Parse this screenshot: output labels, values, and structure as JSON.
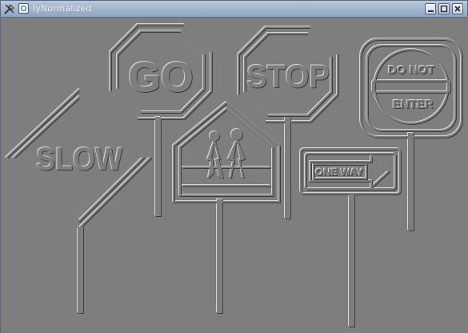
{
  "window": {
    "title": "IyNormalized",
    "buttons": {
      "minimize": "minimize",
      "maximize": "maximize",
      "close": "close"
    }
  },
  "icons": [
    "app-tools-icon",
    "system-menu-icon",
    "minimize-icon",
    "maximize-icon",
    "close-icon"
  ],
  "signs": {
    "go": "GO",
    "stop": "STOP",
    "do_not": "DO NOT",
    "enter": "ENTER",
    "slow": "SLOW",
    "one_way": "ONE WAY"
  },
  "colors": {
    "titlebar": "#a3b6cc",
    "image_gray": "#7e7e7e",
    "highlight": "#d4d4d4",
    "shadow": "#3a3a3a"
  }
}
